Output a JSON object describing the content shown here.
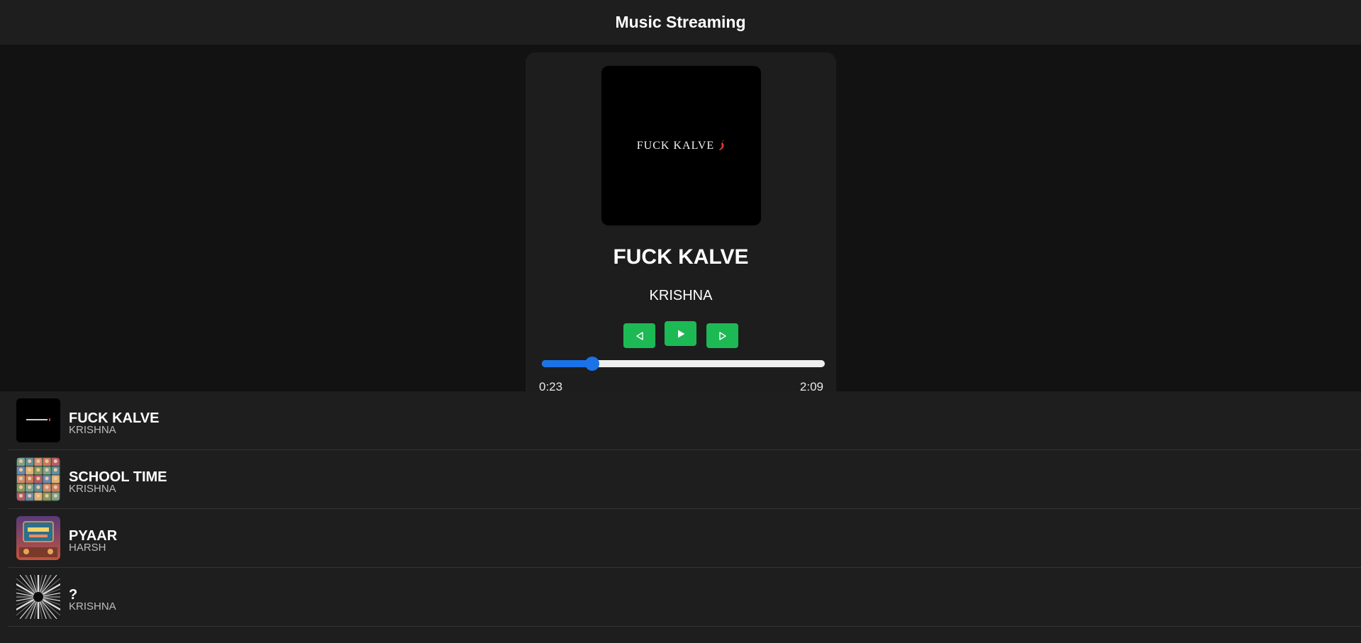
{
  "app": {
    "title": "Music Streaming"
  },
  "now_playing": {
    "cover_text": "FUCK KALVE",
    "title": "FUCK KALVE",
    "artist": "KRISHNA",
    "current_time": "0:23",
    "duration": "2:09",
    "progress_fraction": 0.178
  },
  "controls": {
    "prev_icon": "previous-icon",
    "play_icon": "play-icon",
    "next_icon": "next-icon",
    "accent": "#1db954",
    "seek_color": "#1a73e8"
  },
  "playlist": [
    {
      "title": "FUCK KALVE",
      "artist": "KRISHNA",
      "art": "black cover with text"
    },
    {
      "title": "SCHOOL TIME",
      "artist": "KRISHNA",
      "art": "grid of portraits"
    },
    {
      "title": "PYAAR",
      "artist": "HARSH",
      "art": "retro neon sign"
    },
    {
      "title": "?",
      "artist": "KRISHNA",
      "art": "grayscale burst"
    }
  ]
}
